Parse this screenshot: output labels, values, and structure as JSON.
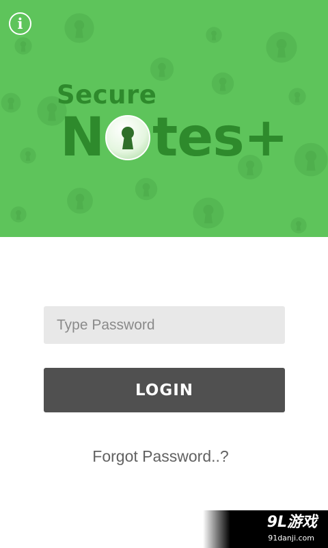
{
  "header": {
    "info_glyph": "i",
    "info_icon": "info-icon",
    "brand_line1": "Secure",
    "brand_first_letter": "N",
    "brand_rest": "tes+",
    "brand_lock_icon": "keyhole-lock-icon"
  },
  "login_form": {
    "password_placeholder": "Type Password",
    "password_value": "",
    "login_label": "LOGIN",
    "forgot_label": "Forgot Password..?"
  },
  "watermark": {
    "main": "9L游戏",
    "sub": "91danji.com"
  },
  "colors": {
    "header_bg": "#5ec45b",
    "brand_text": "#2e8a2c",
    "input_bg": "#e8e8e8",
    "button_bg": "#505050",
    "link_text": "#616161"
  }
}
